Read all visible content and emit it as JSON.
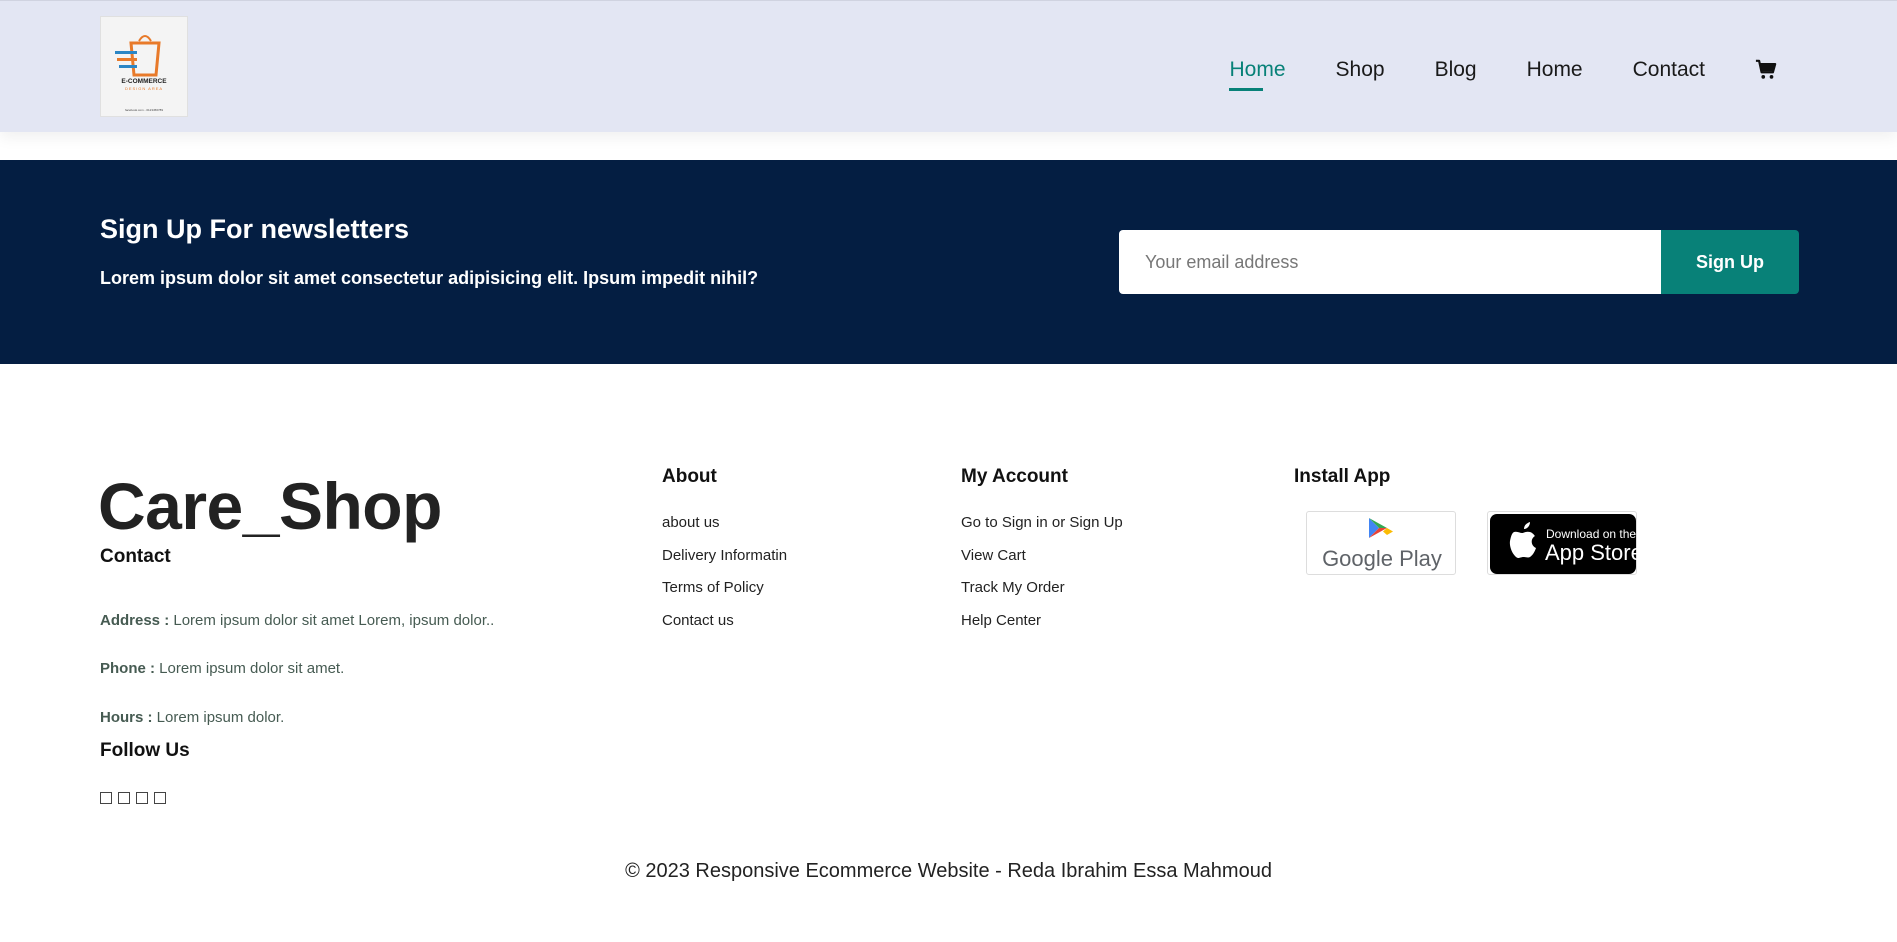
{
  "header": {
    "logo": {
      "name": "E-COMMERCE",
      "subtitle": "DESIGN AREA",
      "contact": "facebook.com - 0123456789"
    },
    "nav": [
      {
        "label": "Home",
        "active": true
      },
      {
        "label": "Shop",
        "active": false
      },
      {
        "label": "Blog",
        "active": false
      },
      {
        "label": "Home",
        "active": false
      },
      {
        "label": "Contact",
        "active": false
      }
    ],
    "cart_icon": "cart-icon"
  },
  "newsletter": {
    "title": "Sign Up For newsletters",
    "text": "Lorem ipsum dolor sit amet consectetur adipisicing elit. Ipsum impedit nihil?",
    "input_placeholder": "Your email address",
    "button_label": "Sign Up"
  },
  "footer": {
    "brand": "Care_Shop",
    "contact": {
      "heading": "Contact",
      "address_label": "Address :",
      "address_value": "Lorem ipsum dolor sit amet Lorem, ipsum dolor..",
      "phone_label": "Phone :",
      "phone_value": "Lorem ipsum dolor sit amet.",
      "hours_label": "Hours :",
      "hours_value": "Lorem ipsum dolor."
    },
    "follow": {
      "heading": "Follow Us",
      "icons": [
        "facebook-icon",
        "twitter-icon",
        "instagram-icon",
        "youtube-icon"
      ]
    },
    "about": {
      "heading": "About",
      "links": [
        "about us",
        "Delivery Informatin",
        "Terms of Policy",
        "Contact us"
      ]
    },
    "account": {
      "heading": "My Account",
      "links": [
        "Go to Sign in or Sign Up",
        "View Cart",
        "Track My Order",
        "Help Center"
      ]
    },
    "install": {
      "heading": "Install App",
      "google_play": {
        "line1": "Google Play"
      },
      "app_store": {
        "line1": "Download on the",
        "line2": "App Store"
      }
    },
    "copyright": "© 2023 Responsive Ecommerce Website - Reda Ibrahim Essa Mahmoud"
  },
  "colors": {
    "accent": "#088178",
    "header_bg": "#e3e6f3",
    "newsletter_bg": "#041e42"
  }
}
